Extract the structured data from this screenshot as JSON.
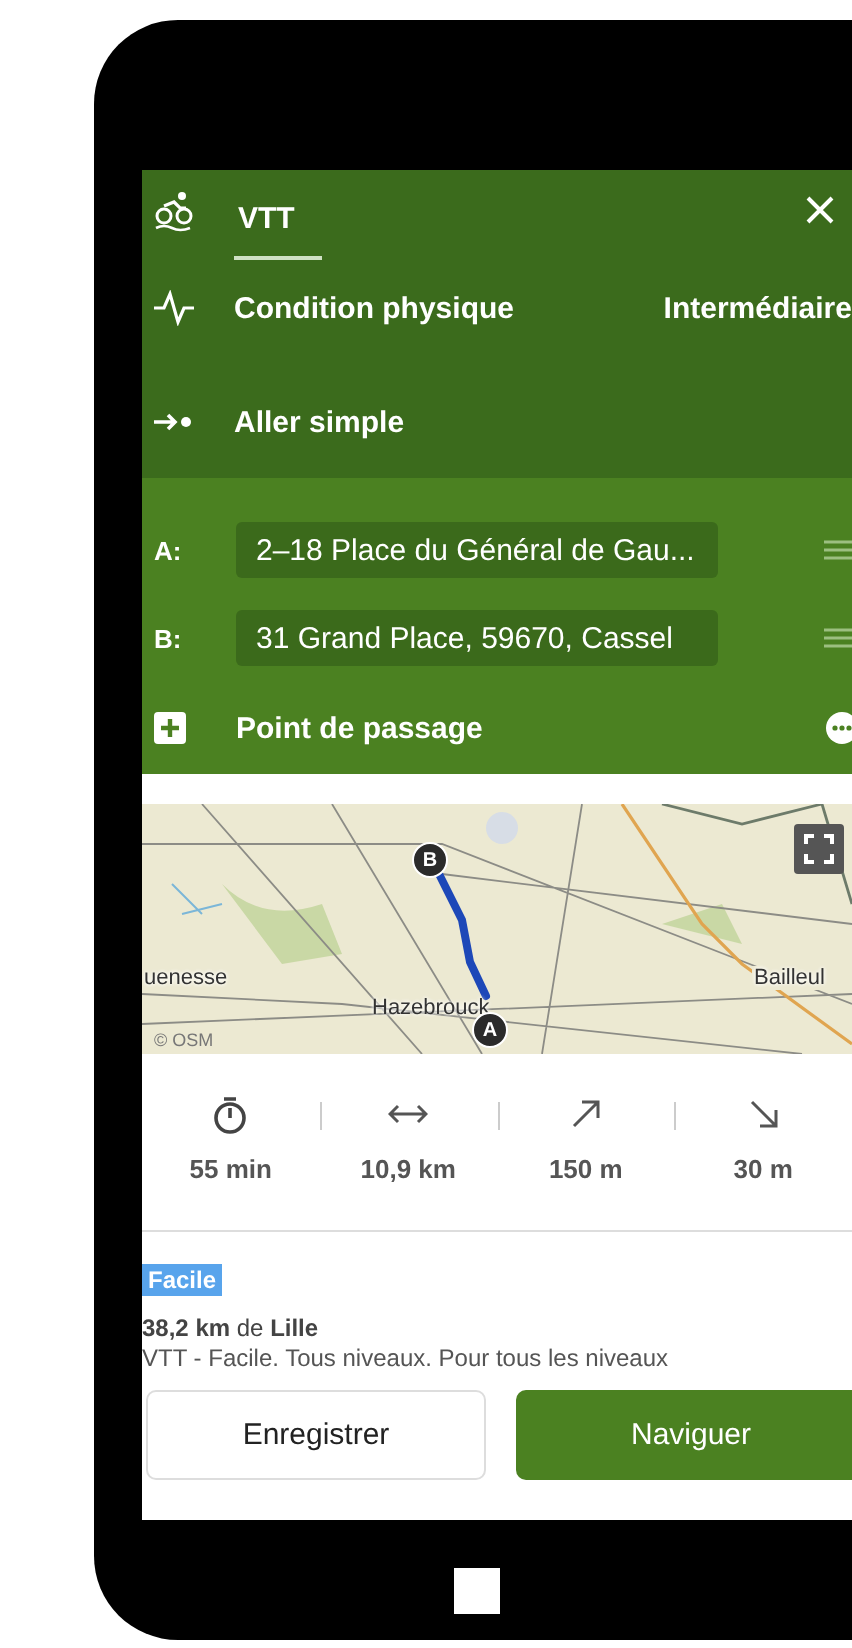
{
  "header": {
    "activity": "VTT"
  },
  "settings": [
    {
      "kind": "fitness",
      "label": "Condition physique",
      "value": "Intermédiaire"
    },
    {
      "kind": "route_type",
      "label": "Aller simple"
    }
  ],
  "waypoints": [
    {
      "letter": "A:",
      "value": "2–18 Place du Général de Gau..."
    },
    {
      "letter": "B:",
      "value": "31 Grand Place, 59670, Cassel"
    }
  ],
  "add_waypoint": "Point de passage",
  "map": {
    "labels": [
      "uenesse",
      "Hazebrouck",
      "Bailleul"
    ],
    "attribution": "© OSM",
    "start_marker": "A",
    "end_marker": "B"
  },
  "stats": [
    {
      "kind": "duration",
      "value": "55 min"
    },
    {
      "kind": "distance",
      "value": "10,9 km"
    },
    {
      "kind": "ascent",
      "value": "150 m"
    },
    {
      "kind": "descent",
      "value": "30 m"
    }
  ],
  "difficulty": "Facile",
  "distance_from": "**38,2 km** de **Lille**",
  "description": "VTT - Facile. Tous niveaux. Pour tous les niveaux",
  "buttons": [
    {
      "kind": "secondary",
      "label": "Enregistrer"
    },
    {
      "kind": "primary",
      "label": "Naviguer"
    }
  ]
}
